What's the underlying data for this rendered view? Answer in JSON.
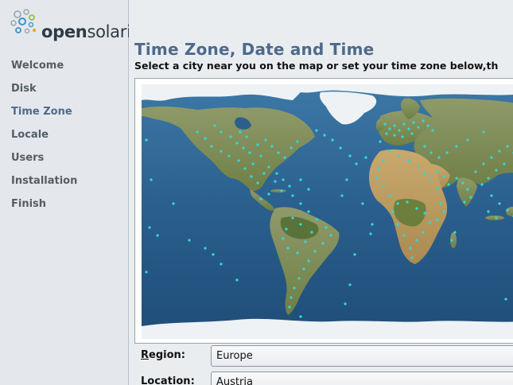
{
  "brand": {
    "logo_text_1": "open",
    "logo_text_2": "solaris"
  },
  "sidebar": {
    "items": [
      {
        "label": "Welcome",
        "active": false
      },
      {
        "label": "Disk",
        "active": false
      },
      {
        "label": "Time Zone",
        "active": true
      },
      {
        "label": "Locale",
        "active": false
      },
      {
        "label": "Users",
        "active": false
      },
      {
        "label": "Installation",
        "active": false
      },
      {
        "label": "Finish",
        "active": false
      }
    ]
  },
  "main": {
    "title": "Time Zone, Date and Time",
    "instruction": "Select a city near you on the map or set your time zone below,th",
    "region": {
      "label_mnemonic": "R",
      "label_rest": "egion:",
      "value": "Europe"
    },
    "location": {
      "label_mnemonic": "L",
      "label_rest": "ocation:",
      "value": "Austria"
    }
  },
  "colors": {
    "accent": "#4d6a8c",
    "ocean": "#2c5f8c",
    "city_marker": "#35d6d0"
  }
}
